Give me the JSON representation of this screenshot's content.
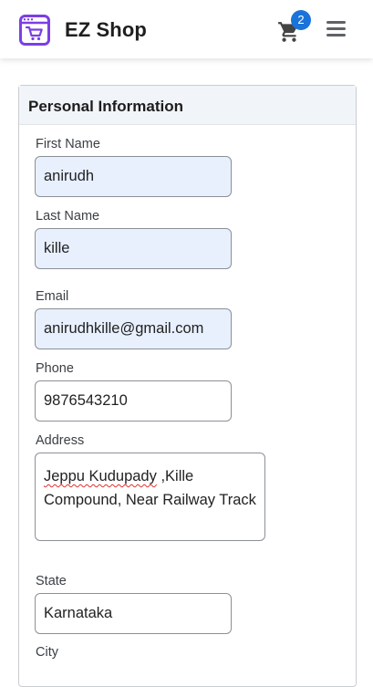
{
  "header": {
    "brand": "EZ Shop",
    "cart_count": "2",
    "icons": [
      "shop-logo-icon",
      "cart-icon",
      "hamburger-menu-icon"
    ],
    "accent_color": "#1a73d9",
    "logo_color": "#7b3fe4"
  },
  "section": {
    "title": "Personal Information"
  },
  "form": {
    "first_name": {
      "label": "First Name",
      "value": "anirudh"
    },
    "last_name": {
      "label": "Last Name",
      "value": "kille"
    },
    "email": {
      "label": "Email",
      "value": "anirudhkille@gmail.com"
    },
    "phone": {
      "label": "Phone",
      "value": "9876543210"
    },
    "address": {
      "label": "Address",
      "value_misspelled": "Jeppu Kudupady",
      "value_rest": " ,Kille Compound, Near Railway Track"
    },
    "state": {
      "label": "State",
      "value": "Karnataka"
    },
    "city": {
      "label": "City"
    }
  }
}
